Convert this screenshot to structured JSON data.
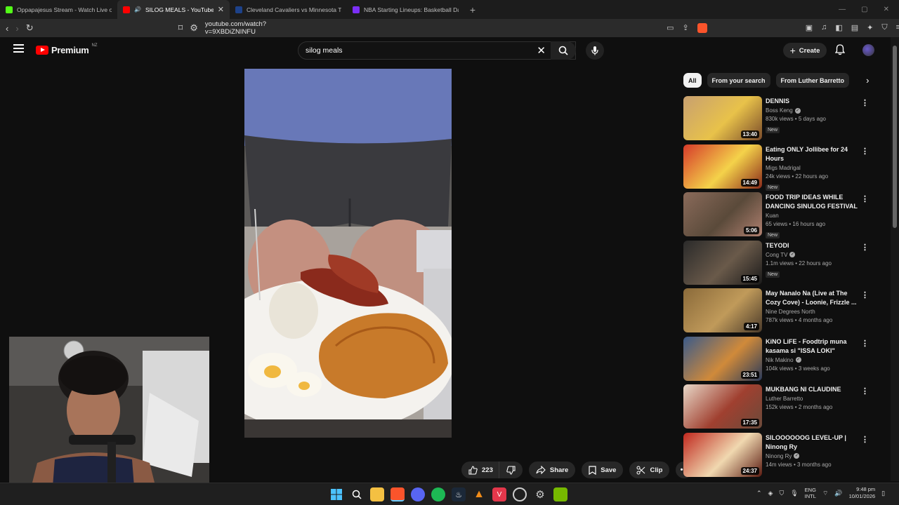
{
  "browser": {
    "tabs": [
      {
        "title": "Oppapajesus Stream - Watch Live on",
        "active": false,
        "color": "#53fc18"
      },
      {
        "title": "SILOG MEALS - YouTube",
        "active": true,
        "color": "#ff0000"
      },
      {
        "title": "Cleveland Cavaliers vs Minnesota Tim",
        "active": false,
        "color": "#1d428a"
      },
      {
        "title": "NBA Starting Lineups: Basketball Dai",
        "active": false,
        "color": "#7b2ff7"
      }
    ],
    "url": "youtube.com/watch?v=9XBDiZNINFU"
  },
  "youtube": {
    "logo": "Premium",
    "country": "NZ",
    "search_value": "silog meals",
    "create_label": "Create"
  },
  "actions": {
    "likes": "223",
    "share": "Share",
    "save": "Save",
    "clip": "Clip"
  },
  "chips": [
    "All",
    "From your search",
    "From Luther Barretto"
  ],
  "recommendations": [
    {
      "title": "DENNIS",
      "channel": "Boss Keng",
      "verified": true,
      "stats": "830k views • 5 days ago",
      "badge": "New",
      "duration": "13:40",
      "thumb": [
        "#c8a070",
        "#e8c24a",
        "#7a4b2a"
      ]
    },
    {
      "title": "Eating ONLY Jollibee for 24 Hours",
      "channel": "Migs Madrigal",
      "verified": false,
      "stats": "24k views • 22 hours ago",
      "badge": "New",
      "duration": "14:49",
      "thumb": [
        "#d63a2a",
        "#f4d24a",
        "#8a2a1a"
      ]
    },
    {
      "title": "FOOD TRIP IDEAS WHILE DANCING SINULOG FESTIVAL ...",
      "channel": "Kuan",
      "verified": false,
      "stats": "65 views • 16 hours ago",
      "badge": "New",
      "duration": "5:06",
      "thumb": [
        "#8a6a5a",
        "#5a4a3a",
        "#b08070"
      ]
    },
    {
      "title": "TEYODI",
      "channel": "Cong TV",
      "verified": true,
      "stats": "1.1m views • 22 hours ago",
      "badge": "New",
      "duration": "15:45",
      "thumb": [
        "#2a2a2a",
        "#6a5a4a",
        "#1a1a1a"
      ]
    },
    {
      "title": "May Nanalo Na (Live at The Cozy Cove) - Loonie, Frizzle ...",
      "channel": "Nine Degrees North",
      "verified": false,
      "stats": "787k views • 4 months ago",
      "badge": "",
      "duration": "4:17",
      "thumb": [
        "#8a6a3a",
        "#c09a5a",
        "#4a3a2a"
      ]
    },
    {
      "title": "KiNO LiFE - Foodtrip muna kasama si \"ISSA LOKI\"",
      "channel": "Nik Makino",
      "verified": true,
      "stats": "104k views • 3 weeks ago",
      "badge": "",
      "duration": "23:51",
      "thumb": [
        "#3a5a8a",
        "#d08a3a",
        "#2a3a5a"
      ]
    },
    {
      "title": "MUKBANG NI CLAUDINE",
      "channel": "Luther Barretto",
      "verified": false,
      "stats": "152k views • 2 months ago",
      "badge": "",
      "duration": "17:35",
      "thumb": [
        "#e8d8c8",
        "#a04030",
        "#6a4a3a"
      ]
    },
    {
      "title": "SILOOOOOOG LEVEL-UP | Ninong Ry",
      "channel": "Ninong Ry",
      "verified": true,
      "stats": "14m views • 3 months ago",
      "badge": "",
      "duration": "24:37",
      "thumb": [
        "#c0281e",
        "#f0d8b0",
        "#5a1a10"
      ]
    }
  ],
  "taskbar": {
    "lang_line1": "ENG",
    "lang_line2": "INTL",
    "time": "9:48 pm",
    "date": "10/01/2026"
  }
}
